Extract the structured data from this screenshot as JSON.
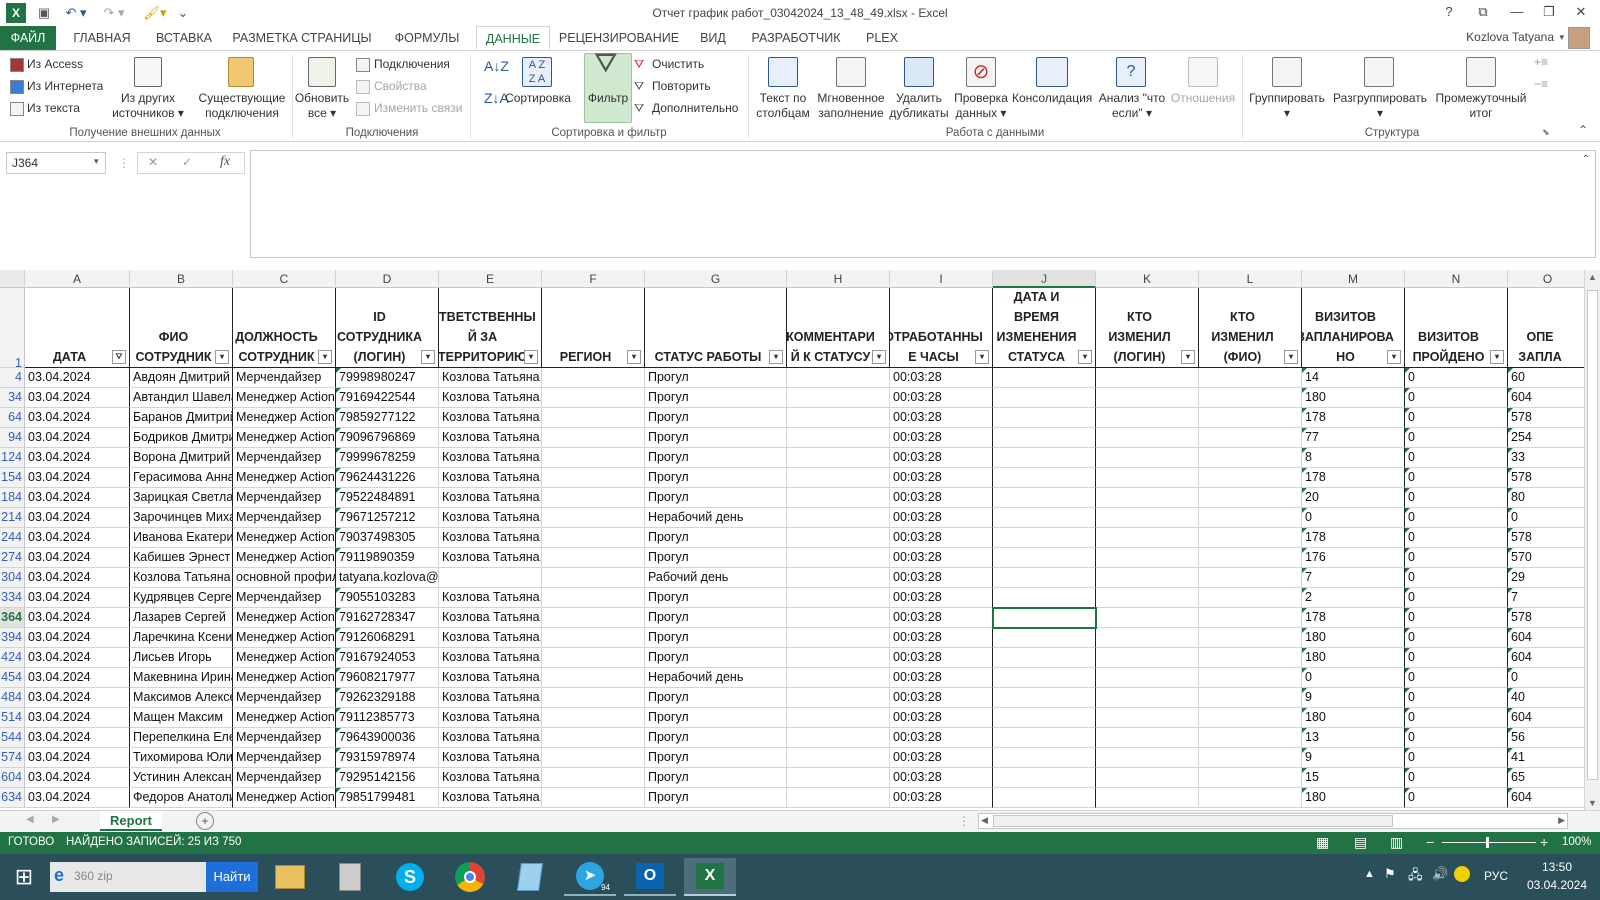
{
  "window": {
    "title": "Отчет график работ_03042024_13_48_49.xlsx - Excel",
    "help": "?",
    "restore_ribbon": "⧉",
    "minimize": "—",
    "maximize": "❐",
    "close": "✕"
  },
  "qat": {
    "app_icon": "excel-icon",
    "save": "💾",
    "undo": "↶",
    "redo": "↷",
    "paint": "🖌",
    "more": "⋮"
  },
  "tabs": [
    {
      "label": "ФАЙЛ"
    },
    {
      "label": "ГЛАВНАЯ"
    },
    {
      "label": "ВСТАВКА"
    },
    {
      "label": "РАЗМЕТКА СТРАНИЦЫ"
    },
    {
      "label": "ФОРМУЛЫ"
    },
    {
      "label": "ДАННЫЕ"
    },
    {
      "label": "РЕЦЕНЗИРОВАНИЕ"
    },
    {
      "label": "ВИД"
    },
    {
      "label": "РАЗРАБОТЧИК"
    },
    {
      "label": "PLEX"
    }
  ],
  "user_name": "Kozlova Tatyana",
  "ribbon": {
    "from_access": "Из Access",
    "from_web": "Из Интернета",
    "from_text": "Из текста",
    "from_other_1": "Из других",
    "from_other_2": "источников",
    "existing_1": "Существующие",
    "existing_2": "подключения",
    "group_external": "Получение внешних данных",
    "refresh_1": "Обновить",
    "refresh_2": "все",
    "connections": "Подключения",
    "properties": "Свойства",
    "edit_links": "Изменить связи",
    "group_connections": "Подключения",
    "sort": "Сортировка",
    "filter": "Фильтр",
    "clear": "Очистить",
    "reapply": "Повторить",
    "advanced": "Дополнительно",
    "group_sort": "Сортировка и фильтр",
    "text_to_cols_1": "Текст по",
    "text_to_cols_2": "столбцам",
    "flash_fill_1": "Мгновенное",
    "flash_fill_2": "заполнение",
    "remove_dup_1": "Удалить",
    "remove_dup_2": "дубликаты",
    "validation_1": "Проверка",
    "validation_2": "данных",
    "consolidate": "Консолидация",
    "whatif_1": "Анализ \"что",
    "whatif_2": "если\"",
    "relationships": "Отношения",
    "group_data_tools": "Работа с данными",
    "group": "Группировать",
    "ungroup": "Разгруппировать",
    "subtotal_1": "Промежуточный",
    "subtotal_2": "итог",
    "group_outline": "Структура"
  },
  "formula": {
    "name_box": "J364",
    "cancel": "✕",
    "enter": "✓",
    "fx": "fx",
    "value": ""
  },
  "columns": [
    "A",
    "B",
    "C",
    "D",
    "E",
    "F",
    "G",
    "H",
    "I",
    "J",
    "K",
    "L",
    "M",
    "N",
    "O"
  ],
  "header_row_number": "1",
  "headers": [
    "ДАТА",
    "ФИО СОТРУДНИК",
    "ДОЛЖНОСТЬ СОТРУДНИК",
    "ID СОТРУДНИКА (ЛОГИН)",
    "ОТВЕТСТВЕННЫ Й ЗА ТЕРРИТОРИЮ",
    "РЕГИОН",
    "СТАТУС РАБОТЫ",
    "КОММЕНТАРИ Й К СТАТУСУ",
    "ОТРАБОТАННЫ Е ЧАСЫ",
    "ДАТА И ВРЕМЯ ИЗМЕНЕНИЯ СТАТУСА",
    "КТО ИЗМЕНИЛ (ЛОГИН)",
    "КТО ИЗМЕНИЛ (ФИО)",
    "ВИЗИТОВ ЗАПЛАНИРОВА НО",
    "ВИЗИТОВ ПРОЙДЕНО",
    "ОПЕ ЗАПЛА"
  ],
  "rows": [
    {
      "n": "4",
      "c": [
        "03.04.2024",
        "Авдоян Дмитрий",
        "Мерчендайзер",
        "79998980247",
        "Козлова Татьяна, Бодриков  Дмитрий",
        "",
        "Прогул",
        "",
        "00:03:28",
        "",
        "",
        "",
        "14",
        "0",
        "60"
      ]
    },
    {
      "n": "34",
      "c": [
        "03.04.2024",
        "Автандил Шавелашвили",
        "Менеджер Action",
        "79169422544",
        "Козлова Татьяна, Макевнина Ирина",
        "",
        "Прогул",
        "",
        "00:03:28",
        "",
        "",
        "",
        "180",
        "0",
        "604"
      ]
    },
    {
      "n": "64",
      "c": [
        "03.04.2024",
        "Баранов Дмитрий",
        "Менеджер Action",
        "79859277122",
        "Козлова Татьяна, Макевнина Ирина",
        "",
        "Прогул",
        "",
        "00:03:28",
        "",
        "",
        "",
        "178",
        "0",
        "578"
      ]
    },
    {
      "n": "94",
      "c": [
        "03.04.2024",
        "Бодриков  Дмитрий",
        "Менеджер Action",
        "79096796869",
        "Козлова Татьяна, Макевнина Ирина",
        "",
        "Прогул",
        "",
        "00:03:28",
        "",
        "",
        "",
        "77",
        "0",
        "254"
      ]
    },
    {
      "n": "124",
      "c": [
        "03.04.2024",
        "Ворона Дмитрий",
        "Мерчендайзер",
        "79999678259",
        "Козлова Татьяна, Бодриков  Дмитрий",
        "",
        "Прогул",
        "",
        "00:03:28",
        "",
        "",
        "",
        "8",
        "0",
        "33"
      ]
    },
    {
      "n": "154",
      "c": [
        "03.04.2024",
        "Герасимова Анна",
        "Менеджер Action",
        "79624431226",
        "Козлова Татьяна, Макевнина Ирина",
        "",
        "Прогул",
        "",
        "00:03:28",
        "",
        "",
        "",
        "178",
        "0",
        "578"
      ]
    },
    {
      "n": "184",
      "c": [
        "03.04.2024",
        "Зарицкая Светлана",
        "Мерчендайзер",
        "79522484891",
        "Козлова Татьяна, Бодриков  Дмитрий",
        "",
        "Прогул",
        "",
        "00:03:28",
        "",
        "",
        "",
        "20",
        "0",
        "80"
      ]
    },
    {
      "n": "214",
      "c": [
        "03.04.2024",
        "Зарочинцев Михаил",
        "Мерчендайзер",
        "79671257212",
        "Козлова Татьяна, Бодриков  Дмитрий",
        "",
        "Нерабочий день",
        "",
        "00:03:28",
        "",
        "",
        "",
        "0",
        "0",
        "0"
      ]
    },
    {
      "n": "244",
      "c": [
        "03.04.2024",
        "Иванова Екатерина",
        "Менеджер Action",
        "79037498305",
        "Козлова Татьяна, Макевнина Ирина",
        "",
        "Прогул",
        "",
        "00:03:28",
        "",
        "",
        "",
        "178",
        "0",
        "578"
      ]
    },
    {
      "n": "274",
      "c": [
        "03.04.2024",
        "Кабишев  Эрнест",
        "Менеджер Action",
        "79119890359",
        "Козлова Татьяна, Макевнина Ирина",
        "",
        "Прогул",
        "",
        "00:03:28",
        "",
        "",
        "",
        "176",
        "0",
        "570"
      ]
    },
    {
      "n": "304",
      "c": [
        "03.04.2024",
        "Козлова Татьяна",
        "основной профиль",
        "tatyana.kozlova@msk.action.ru",
        "",
        "",
        "Рабочий день",
        "",
        "00:03:28",
        "",
        "",
        "",
        "7",
        "0",
        "29"
      ]
    },
    {
      "n": "334",
      "c": [
        "03.04.2024",
        "Кудрявцев Сергей",
        "Мерчендайзер",
        "79055103283",
        "Козлова Татьяна, Бодриков  Дмитрий",
        "",
        "Прогул",
        "",
        "00:03:28",
        "",
        "",
        "",
        "2",
        "0",
        "7"
      ]
    },
    {
      "n": "364",
      "c": [
        "03.04.2024",
        "Лазарев Сергей",
        "Менеджер Action",
        "79162728347",
        "Козлова Татьяна, Макевнина Ирина",
        "",
        "Прогул",
        "",
        "00:03:28",
        "",
        "",
        "",
        "178",
        "0",
        "578"
      ]
    },
    {
      "n": "394",
      "c": [
        "03.04.2024",
        "Ларечкина Ксения",
        "Менеджер Action",
        "79126068291",
        "Козлова Татьяна, Макевнина Ирина",
        "",
        "Прогул",
        "",
        "00:03:28",
        "",
        "",
        "",
        "180",
        "0",
        "604"
      ]
    },
    {
      "n": "424",
      "c": [
        "03.04.2024",
        "Лисьев Игорь",
        "Менеджер Action",
        "79167924053",
        "Козлова Татьяна, Макевнина Ирина",
        "",
        "Прогул",
        "",
        "00:03:28",
        "",
        "",
        "",
        "180",
        "0",
        "604"
      ]
    },
    {
      "n": "454",
      "c": [
        "03.04.2024",
        "Макевнина Ирина",
        "Менеджер Action",
        "79608217977",
        "Козлова Татьяна, Королькова Ксения",
        "",
        "Нерабочий день",
        "",
        "00:03:28",
        "",
        "",
        "",
        "0",
        "0",
        "0"
      ]
    },
    {
      "n": "484",
      "c": [
        "03.04.2024",
        "Максимов Алексей",
        "Мерчендайзер",
        "79262329188",
        "Козлова Татьяна, Бодриков  Дмитрий",
        "",
        "Прогул",
        "",
        "00:03:28",
        "",
        "",
        "",
        "9",
        "0",
        "40"
      ]
    },
    {
      "n": "514",
      "c": [
        "03.04.2024",
        "Мащен Максим",
        "Менеджер Action",
        "79112385773",
        "Козлова Татьяна, Макевнина Ирина",
        "",
        "Прогул",
        "",
        "00:03:28",
        "",
        "",
        "",
        "180",
        "0",
        "604"
      ]
    },
    {
      "n": "544",
      "c": [
        "03.04.2024",
        "Перепелкина Елена",
        "Мерчендайзер",
        "79643900036",
        "Козлова Татьяна, Бодриков  Дмитрий",
        "",
        "Прогул",
        "",
        "00:03:28",
        "",
        "",
        "",
        "13",
        "0",
        "56"
      ]
    },
    {
      "n": "574",
      "c": [
        "03.04.2024",
        "Тихомирова  Юлия",
        "Мерчендайзер",
        "79315978974",
        "Козлова Татьяна, Бодриков  Дмитрий",
        "",
        "Прогул",
        "",
        "00:03:28",
        "",
        "",
        "",
        "9",
        "0",
        "41"
      ]
    },
    {
      "n": "604",
      "c": [
        "03.04.2024",
        "Устинин Александр",
        "Мерчендайзер",
        "79295142156",
        "Козлова Татьяна, Бодриков  Дмитрий",
        "",
        "Прогул",
        "",
        "00:03:28",
        "",
        "",
        "",
        "15",
        "0",
        "65"
      ]
    },
    {
      "n": "634",
      "c": [
        "03.04.2024",
        "Федоров Анатолий",
        "Менеджер Action",
        "79851799481",
        "Козлова Татьяна, Макевнина Ирина",
        "",
        "Прогул",
        "",
        "00:03:28",
        "",
        "",
        "",
        "180",
        "0",
        "604"
      ]
    }
  ],
  "sheet": {
    "tab": "Report",
    "add": "+"
  },
  "status": {
    "ready": "ГОТОВО",
    "found": "НАЙДЕНО ЗАПИСЕЙ: 25 ИЗ 750",
    "zoom": "100%"
  },
  "taskbar": {
    "search_placeholder": "360 zip",
    "search_button": "Найти",
    "telegram_badge": "94",
    "lang": "РУС",
    "time": "13:50",
    "date": "03.04.2024"
  },
  "colors": {
    "excel_green": "#217346",
    "taskbar": "#2a4e5a",
    "selection": "#217346"
  }
}
